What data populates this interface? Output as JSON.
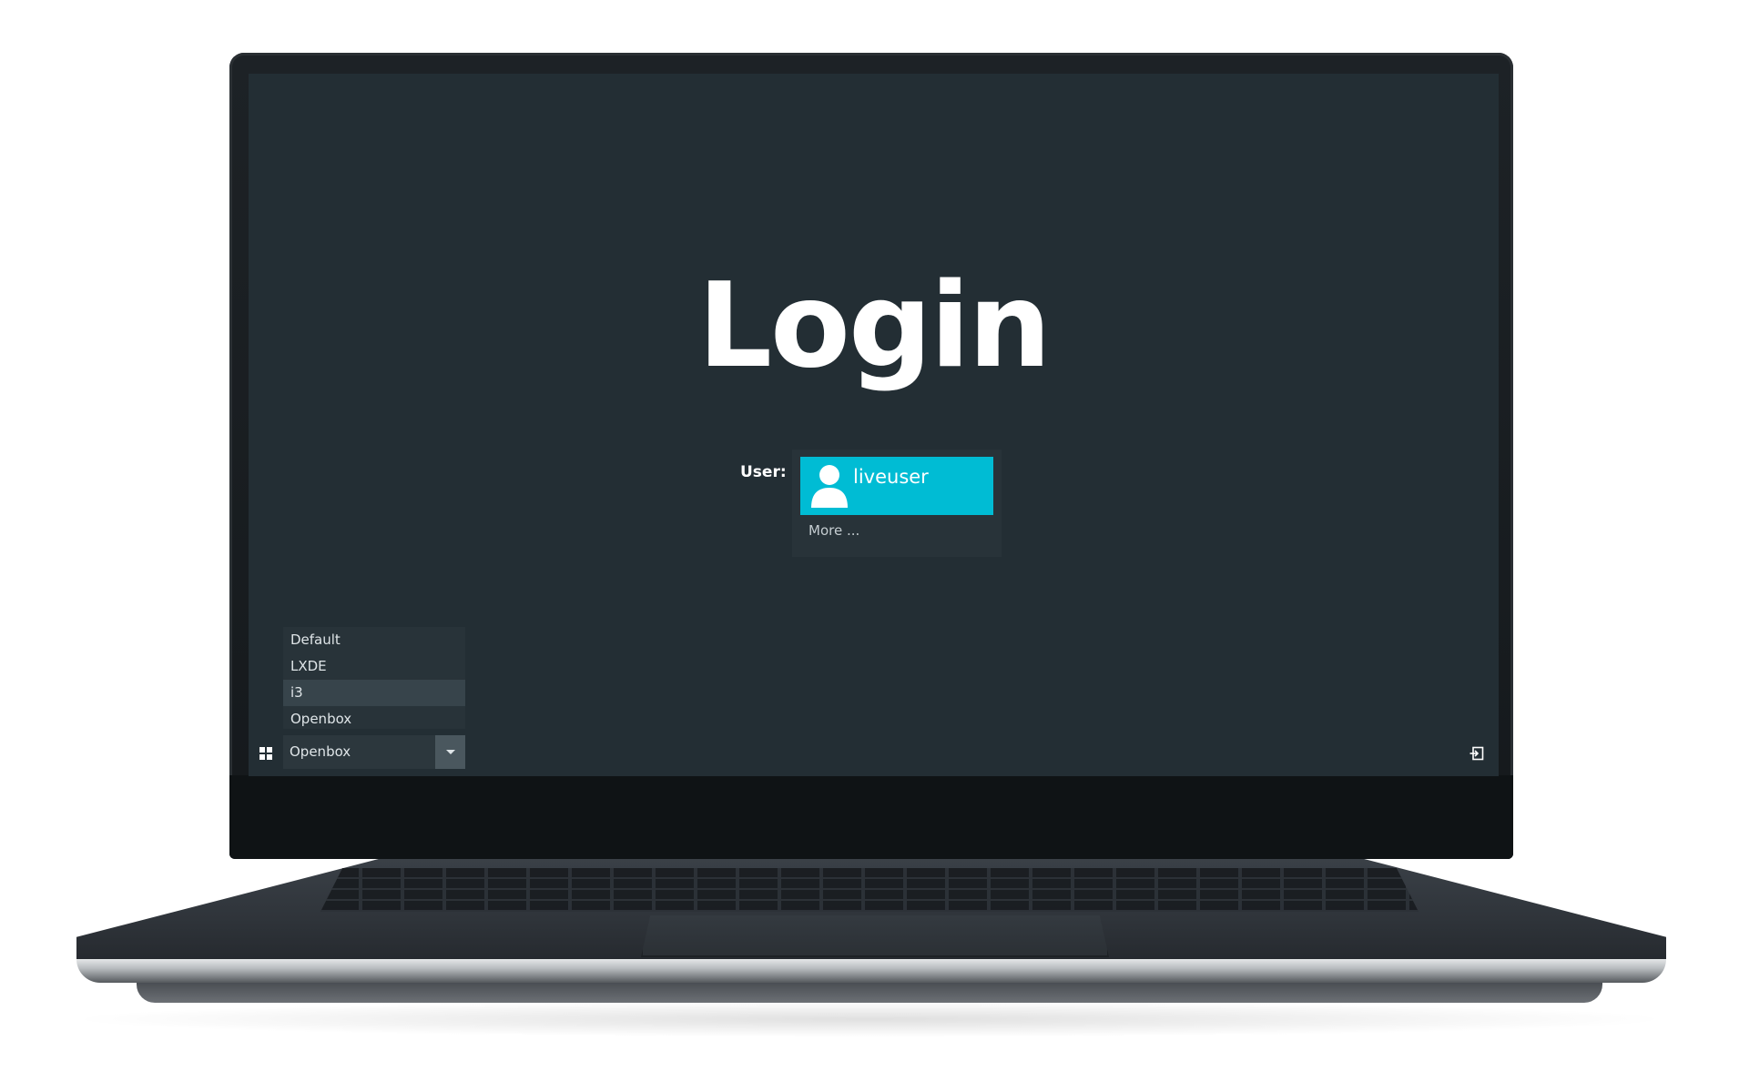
{
  "login": {
    "title": "Login",
    "user_label": "User:",
    "users": [
      {
        "name": "liveuser",
        "icon": "user-avatar-icon",
        "selected": true
      }
    ],
    "more_label": "More ..."
  },
  "session": {
    "options": [
      "Default",
      "LXDE",
      "i3",
      "Openbox"
    ],
    "hovered_option": "i3",
    "selected": "Openbox"
  },
  "icons": {
    "session_menu": "grid-icon",
    "shutdown": "exit-icon"
  },
  "colors": {
    "screen_background": "#232e34",
    "accent": "#00bcd4",
    "panel": "#283339"
  }
}
